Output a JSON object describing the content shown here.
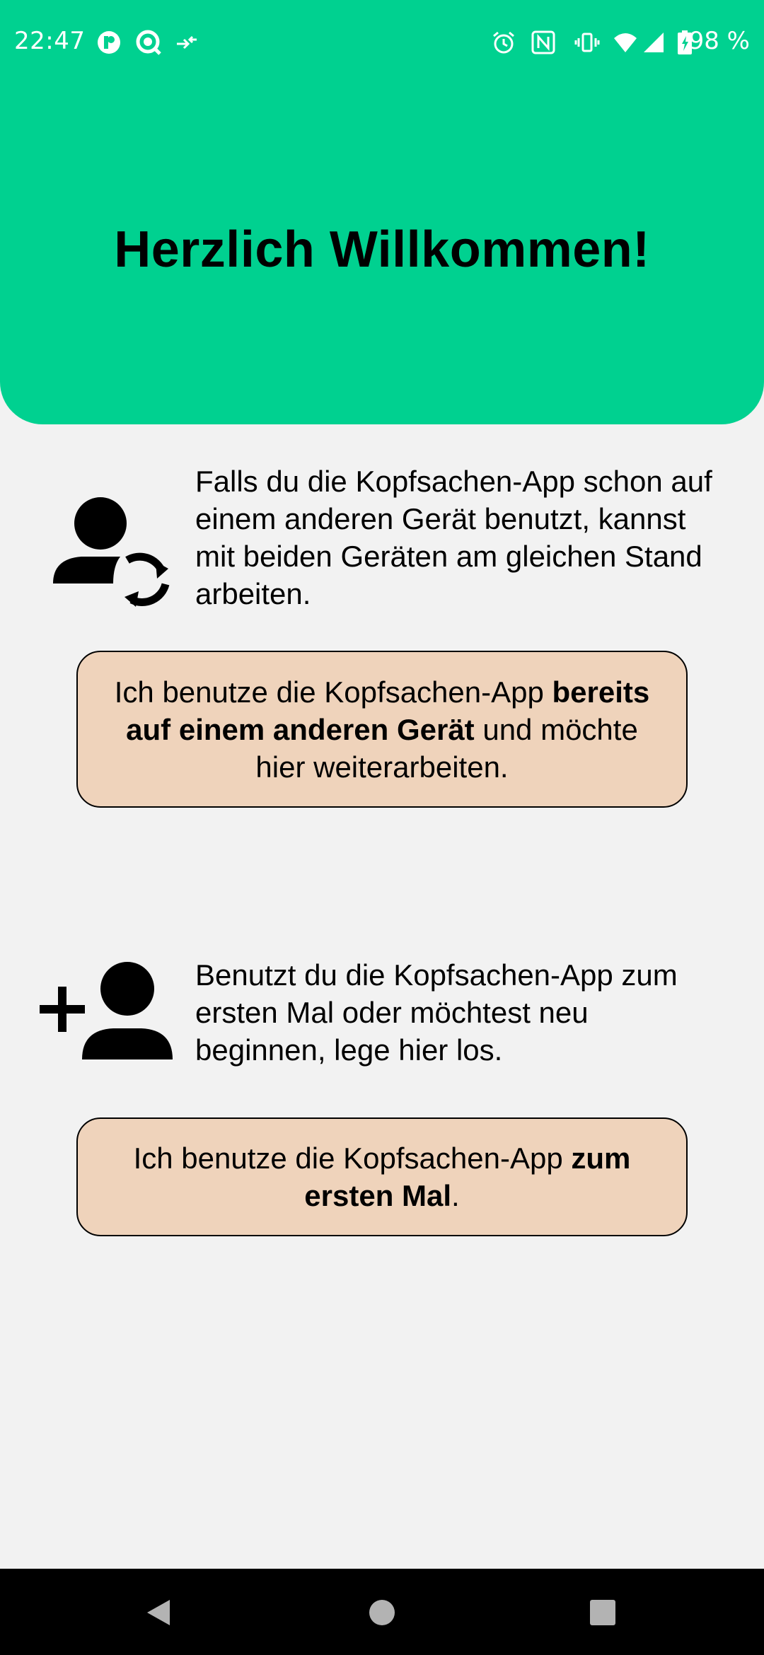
{
  "status_bar": {
    "time": "22:47",
    "battery_percent": "98 %",
    "left_icons": [
      "app-notification-icon",
      "search-app-icon",
      "data-transfer-icon"
    ],
    "right_icons": [
      "alarm-icon",
      "nfc-icon",
      "vibrate-icon",
      "wifi-icon",
      "cell-signal-icon",
      "battery-icon"
    ]
  },
  "header": {
    "title": "Herzlich Willkommen!",
    "background_color": "#00d190"
  },
  "existing_device": {
    "icon": "person-sync-icon",
    "description": "Falls du die Kopfsachen-App schon auf einem anderen Gerät benutzt, kannst mit beiden Geräten am gleichen Stand arbeiten.",
    "button": {
      "prefix": "Ich benutze die Kopfsachen-App ",
      "bold": "bereits auf einem anderen Gerät",
      "suffix": " und möchte hier weiterarbeiten."
    }
  },
  "new_user": {
    "icon": "person-add-icon",
    "description": "Benutzt du die Kopfsachen-App zum ersten Mal oder möchtest neu beginnen, lege hier los.",
    "button": {
      "prefix": "Ich benutze die Kopfsachen-App ",
      "bold": "zum ersten Mal",
      "suffix": "."
    }
  },
  "button_color": "#efd3bb",
  "nav_bar": {
    "items": [
      "back-icon",
      "home-icon",
      "recents-icon"
    ]
  }
}
